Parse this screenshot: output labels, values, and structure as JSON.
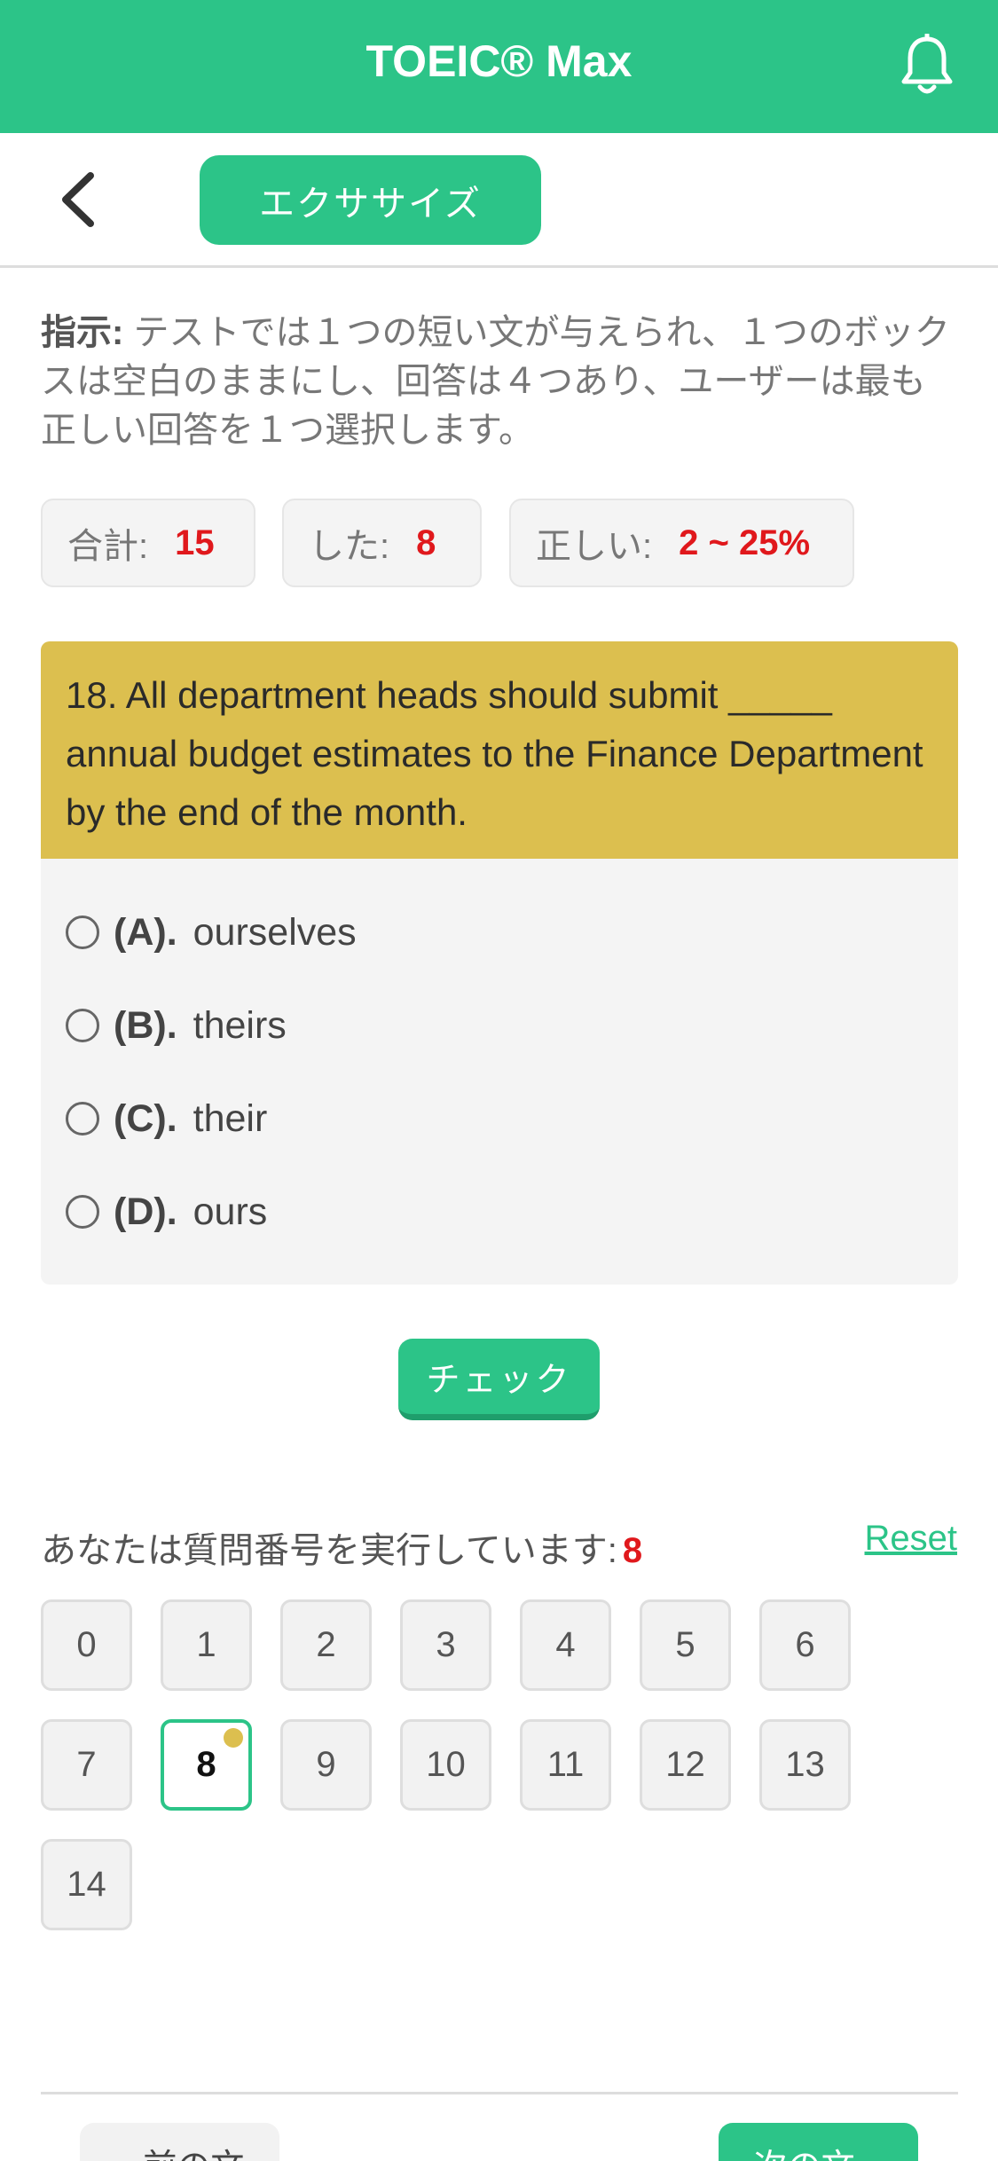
{
  "appbar": {
    "title": "TOEIC® Max"
  },
  "subbar": {
    "tab_label": "エクササイズ"
  },
  "instructions": {
    "label": "指示:",
    "text": " テストでは１つの短い文が与えられ、１つのボックスは空白のままにし、回答は４つあり、ユーザーは最も正しい回答を１つ選択します。"
  },
  "stats": {
    "total_label": "合計:",
    "total_value": "15",
    "done_label": "した:",
    "done_value": "8",
    "correct_label": "正しい:",
    "correct_value": "2 ~ 25%"
  },
  "question": {
    "text": "18. All department heads should submit _____ annual budget estimates to the Finance Department by the end of the month.",
    "options": [
      {
        "letter": "(A).",
        "text": "ourselves"
      },
      {
        "letter": "(B).",
        "text": "theirs"
      },
      {
        "letter": "(C).",
        "text": "their"
      },
      {
        "letter": "(D).",
        "text": "ours"
      }
    ]
  },
  "check_label": "チェック",
  "progress": {
    "running_label": "あなたは質問番号を実行しています:",
    "current": "8",
    "reset_label": "Reset",
    "numbers": [
      "0",
      "1",
      "2",
      "3",
      "4",
      "5",
      "6",
      "7",
      "8",
      "9",
      "10",
      "11",
      "12",
      "13",
      "14"
    ]
  },
  "nav": {
    "prev_label": "« 前の文",
    "next_label": "次の文 »"
  },
  "colors": {
    "accent": "#2cc488",
    "question_bg": "#dcbf4f",
    "highlight": "#e0181c"
  },
  "icons": {
    "bell": "bell-icon",
    "back": "chevron-left-icon"
  }
}
